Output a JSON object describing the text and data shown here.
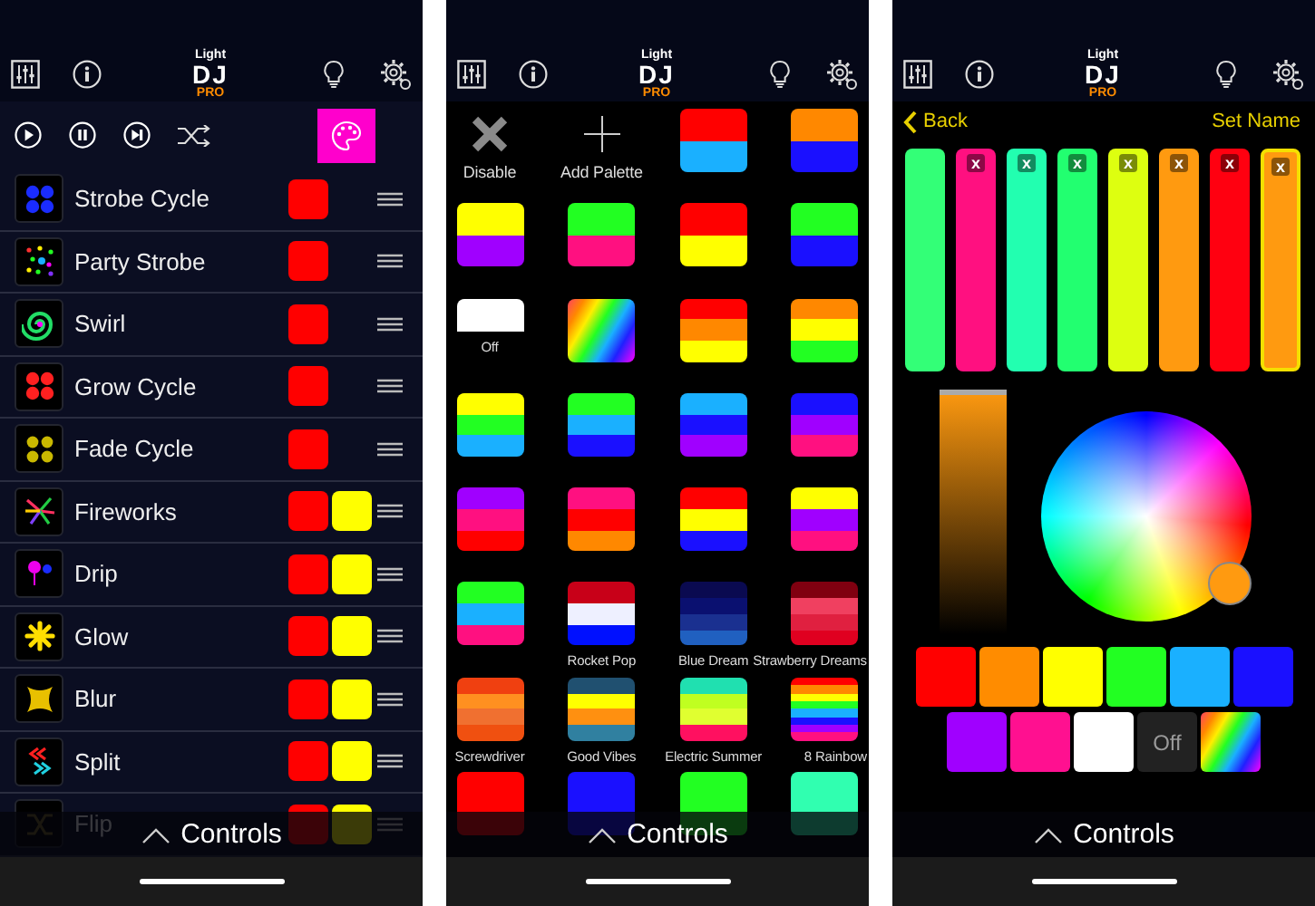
{
  "screens": [
    {
      "kind": "effects",
      "logo": {
        "small": "Light",
        "main": "DJ",
        "badge": "PRO"
      },
      "effects": [
        {
          "name": "Strobe Cycle",
          "kind": "strobe",
          "swatches": [
            {
              "color": "#ff0000"
            }
          ]
        },
        {
          "name": "Party Strobe",
          "kind": "party",
          "swatches": [
            {
              "color": "#ff0000"
            }
          ]
        },
        {
          "name": "Swirl",
          "kind": "swirl",
          "swatches": [
            {
              "color": "#ff0000"
            }
          ]
        },
        {
          "name": "Grow Cycle",
          "kind": "grow",
          "swatches": [
            {
              "color": "#ff0000"
            }
          ]
        },
        {
          "name": "Fade Cycle",
          "kind": "fade",
          "swatches": [
            {
              "color": "#ff0000"
            }
          ]
        },
        {
          "name": "Fireworks",
          "kind": "fireworks",
          "swatches": [
            {
              "color": "#ff0000"
            },
            {
              "color": "#ffff00"
            }
          ]
        },
        {
          "name": "Drip",
          "kind": "drip",
          "swatches": [
            {
              "color": "#ff0000"
            },
            {
              "color": "#ffff00"
            }
          ]
        },
        {
          "name": "Glow",
          "kind": "glow",
          "swatches": [
            {
              "color": "#ff0000"
            },
            {
              "color": "#ffff00"
            }
          ]
        },
        {
          "name": "Blur",
          "kind": "blur",
          "swatches": [
            {
              "color": "#ff0000"
            },
            {
              "color": "#ffff00"
            }
          ]
        },
        {
          "name": "Split",
          "kind": "split",
          "swatches": [
            {
              "color": "#ff0000"
            },
            {
              "color": "#ffff00"
            }
          ]
        },
        {
          "name": "Flip",
          "kind": "flip",
          "swatches": [
            {
              "color": "#ff0000"
            },
            {
              "color": "#ffff00"
            }
          ]
        }
      ],
      "controls": "Controls"
    },
    {
      "kind": "palettes",
      "logo": {
        "small": "Light",
        "main": "DJ",
        "badge": "PRO"
      },
      "palettes": [
        {
          "kind": "disable",
          "label": "Disable"
        },
        {
          "kind": "add",
          "label": "Add Palette"
        },
        {
          "kind": "stripes",
          "stripes": [
            {
              "color": "#ff0000"
            },
            {
              "color": "#1ab0ff"
            }
          ]
        },
        {
          "kind": "stripes",
          "stripes": [
            {
              "color": "#ff8800"
            },
            {
              "color": "#1a10ff"
            }
          ]
        },
        {
          "kind": "stripes",
          "stripes": [
            {
              "color": "#ffff00"
            },
            {
              "color": "#a000ff"
            }
          ]
        },
        {
          "kind": "stripes",
          "stripes": [
            {
              "color": "#22ff22"
            },
            {
              "color": "#ff1080"
            }
          ]
        },
        {
          "kind": "stripes",
          "stripes": [
            {
              "color": "#ff0000"
            },
            {
              "color": "#ffff00"
            }
          ]
        },
        {
          "kind": "stripes",
          "stripes": [
            {
              "color": "#22ff22"
            },
            {
              "color": "#1a10ff"
            }
          ]
        },
        {
          "kind": "off",
          "label": "Off",
          "color": "#ffffff"
        },
        {
          "kind": "rainbow"
        },
        {
          "kind": "stripes",
          "stripes": [
            {
              "color": "#ff0000"
            },
            {
              "color": "#ff8800"
            },
            {
              "color": "#ffff00"
            }
          ]
        },
        {
          "kind": "stripes",
          "stripes": [
            {
              "color": "#ff8800"
            },
            {
              "color": "#ffff00"
            },
            {
              "color": "#22ff22"
            }
          ]
        },
        {
          "kind": "stripes",
          "stripes": [
            {
              "color": "#ffff00"
            },
            {
              "color": "#22ff22"
            },
            {
              "color": "#1ab0ff"
            }
          ]
        },
        {
          "kind": "stripes",
          "stripes": [
            {
              "color": "#22ff22"
            },
            {
              "color": "#1ab0ff"
            },
            {
              "color": "#1a10ff"
            }
          ]
        },
        {
          "kind": "stripes",
          "stripes": [
            {
              "color": "#1ab0ff"
            },
            {
              "color": "#1a10ff"
            },
            {
              "color": "#a000ff"
            }
          ]
        },
        {
          "kind": "stripes",
          "stripes": [
            {
              "color": "#1a10ff"
            },
            {
              "color": "#a000ff"
            },
            {
              "color": "#ff1080"
            }
          ]
        },
        {
          "kind": "stripes",
          "stripes": [
            {
              "color": "#a000ff"
            },
            {
              "color": "#ff1080"
            },
            {
              "color": "#ff0000"
            }
          ]
        },
        {
          "kind": "stripes",
          "stripes": [
            {
              "color": "#ff1080"
            },
            {
              "color": "#ff0000"
            },
            {
              "color": "#ff8800"
            }
          ]
        },
        {
          "kind": "stripes",
          "stripes": [
            {
              "color": "#ff0000"
            },
            {
              "color": "#ffff00"
            },
            {
              "color": "#1a10ff"
            }
          ]
        },
        {
          "kind": "stripes",
          "stripes": [
            {
              "color": "#ffff00"
            },
            {
              "color": "#a000ff"
            },
            {
              "color": "#ff1080"
            }
          ]
        },
        {
          "kind": "stripes",
          "stripes": [
            {
              "color": "#22ff22"
            },
            {
              "color": "#1ab0ff"
            },
            {
              "color": "#ff1080"
            }
          ]
        },
        {
          "kind": "stripes",
          "label": "Rocket Pop",
          "stripes": [
            {
              "color": "#c80018"
            },
            {
              "color": "#eef0ff"
            },
            {
              "color": "#0010ff"
            }
          ]
        },
        {
          "kind": "stripes",
          "label": "Blue Dream",
          "stripes": [
            {
              "color": "#0a0a50"
            },
            {
              "color": "#0a1070"
            },
            {
              "color": "#1a3090"
            },
            {
              "color": "#2060c0"
            }
          ]
        },
        {
          "kind": "stripes",
          "label": "Strawberry Dreams",
          "stripes": [
            {
              "color": "#800010"
            },
            {
              "color": "#f04060"
            },
            {
              "color": "#e02040"
            },
            {
              "color": "#e00020"
            }
          ]
        },
        {
          "kind": "stripes",
          "label": "Screwdriver",
          "stripes": [
            {
              "color": "#f04010"
            },
            {
              "color": "#ff9020"
            },
            {
              "color": "#f07030"
            },
            {
              "color": "#f05010"
            }
          ]
        },
        {
          "kind": "stripes",
          "label": "Good Vibes",
          "stripes": [
            {
              "color": "#205070"
            },
            {
              "color": "#ffff00"
            },
            {
              "color": "#ff9010"
            },
            {
              "color": "#3080a0"
            }
          ]
        },
        {
          "kind": "stripes",
          "label": "Electric Summer",
          "stripes": [
            {
              "color": "#20e0b0"
            },
            {
              "color": "#c0ff20"
            },
            {
              "color": "#e0ff30"
            },
            {
              "color": "#ff1060"
            }
          ]
        },
        {
          "kind": "stripes",
          "label": "8 Rainbow",
          "stripes": [
            {
              "color": "#ff0000"
            },
            {
              "color": "#ff8800"
            },
            {
              "color": "#ffff00"
            },
            {
              "color": "#22ff22"
            },
            {
              "color": "#1ab0ff"
            },
            {
              "color": "#1a10ff"
            },
            {
              "color": "#a000ff"
            },
            {
              "color": "#ff1080"
            }
          ]
        },
        {
          "kind": "stripes",
          "stripes": [
            {
              "color": "#ff0000"
            }
          ]
        },
        {
          "kind": "stripes",
          "stripes": [
            {
              "color": "#1a10ff"
            }
          ]
        },
        {
          "kind": "stripes",
          "stripes": [
            {
              "color": "#22ff22"
            }
          ]
        },
        {
          "kind": "stripes",
          "stripes": [
            {
              "color": "#30ffb0"
            }
          ]
        }
      ],
      "controls": "Controls"
    },
    {
      "kind": "editor",
      "logo": {
        "small": "Light",
        "main": "DJ",
        "badge": "PRO"
      },
      "back": "Back",
      "set_name": "Set Name",
      "bars": [
        {
          "color": "#33ff77",
          "selected": false
        },
        {
          "color": "#ff1080",
          "remove": "x",
          "selected": false
        },
        {
          "color": "#22ffb0",
          "remove": "x",
          "selected": false
        },
        {
          "color": "#22ff70",
          "remove": "x",
          "selected": false
        },
        {
          "color": "#ddff10",
          "remove": "x",
          "selected": false
        },
        {
          "color": "#ff9a10",
          "remove": "x",
          "selected": false
        },
        {
          "color": "#ff0010",
          "remove": "x",
          "selected": false
        },
        {
          "color": "#ff9a10",
          "remove": "x",
          "selected": true
        }
      ],
      "brightness": {
        "level": 1
      },
      "presets": [
        {
          "kind": "solid",
          "color": "#ff0000"
        },
        {
          "kind": "solid",
          "color": "#ff8c00"
        },
        {
          "kind": "solid",
          "color": "#ffff00"
        },
        {
          "kind": "solid",
          "color": "#22ff22"
        },
        {
          "kind": "solid",
          "color": "#1ab0ff"
        },
        {
          "kind": "solid",
          "color": "#1a10ff"
        },
        {
          "kind": "solid",
          "color": "#a000ff"
        },
        {
          "kind": "solid",
          "color": "#ff1090"
        },
        {
          "kind": "solid",
          "color": "#ffffff"
        },
        {
          "kind": "off",
          "label": "Off"
        },
        {
          "kind": "rainbow"
        }
      ],
      "controls": "Controls"
    }
  ]
}
